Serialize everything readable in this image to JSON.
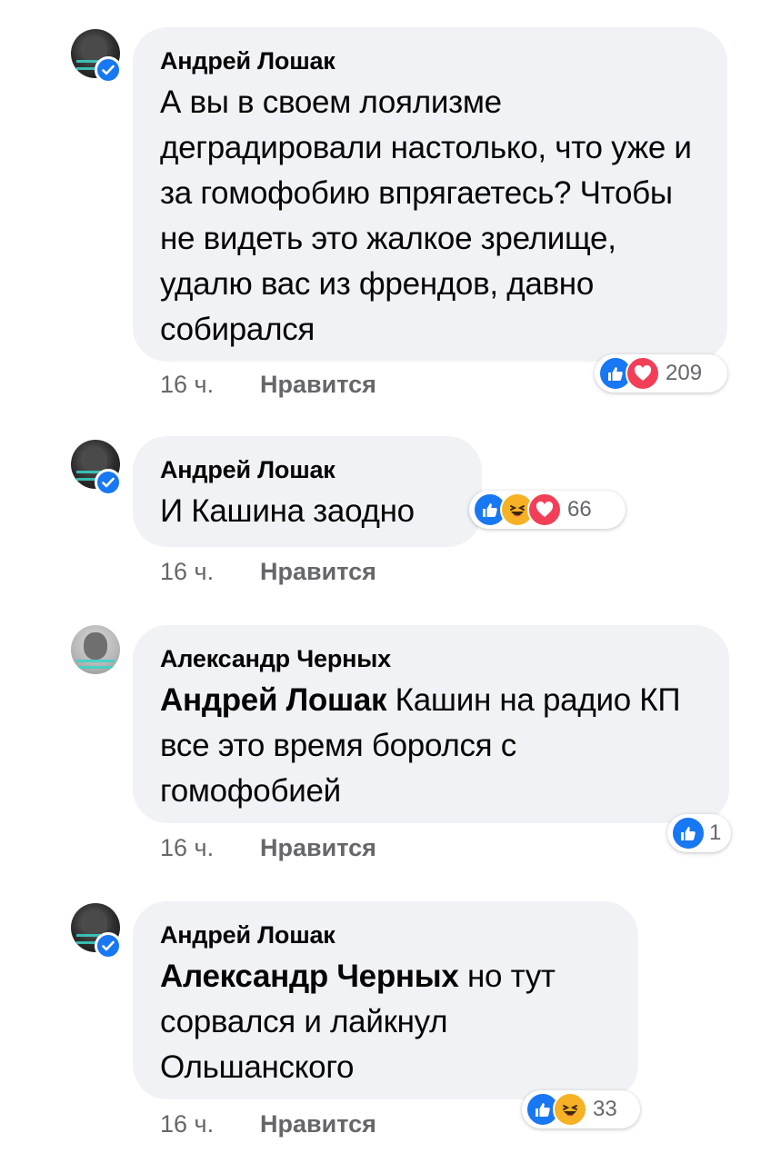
{
  "comments": [
    {
      "author": "Андрей Лошак",
      "mention": "",
      "text": "А вы в своем лоялизме деградировали настолько, что уже и за гомофобию впрягаетесь? Чтобы не видеть это жалкое зрелище, удалю вас из френдов, давно собирался",
      "time": "16 ч.",
      "like_label": "Нравится",
      "reactions": [
        "like-icon",
        "love-icon"
      ],
      "reaction_count": "209",
      "verified": true
    },
    {
      "author": "Андрей Лошак",
      "mention": "",
      "text": "И Кашина заодно",
      "time": "16 ч.",
      "like_label": "Нравится",
      "reactions": [
        "like-icon",
        "haha-icon",
        "love-icon"
      ],
      "reaction_count": "66",
      "verified": true
    },
    {
      "author": "Александр Черных",
      "mention": "Андрей Лошак",
      "text": "Кашин на радио КП все это время боролся с гомофобией",
      "time": "16 ч.",
      "like_label": "Нравится",
      "reactions": [
        "like-icon"
      ],
      "reaction_count": "1",
      "verified": false
    },
    {
      "author": "Андрей Лошак",
      "mention": "Александр Черных",
      "text": "но тут сорвался и лайкнул Ольшанского",
      "time": "16 ч.",
      "like_label": "Нравится",
      "reactions": [
        "like-icon",
        "haha-icon"
      ],
      "reaction_count": "33",
      "verified": true
    }
  ],
  "colors": {
    "bubble": "#f0f2f5",
    "meta_text": "#65676b",
    "facebook_blue": "#1877f2",
    "love_red": "#f33e58",
    "haha_yellow": "#f7b125"
  }
}
